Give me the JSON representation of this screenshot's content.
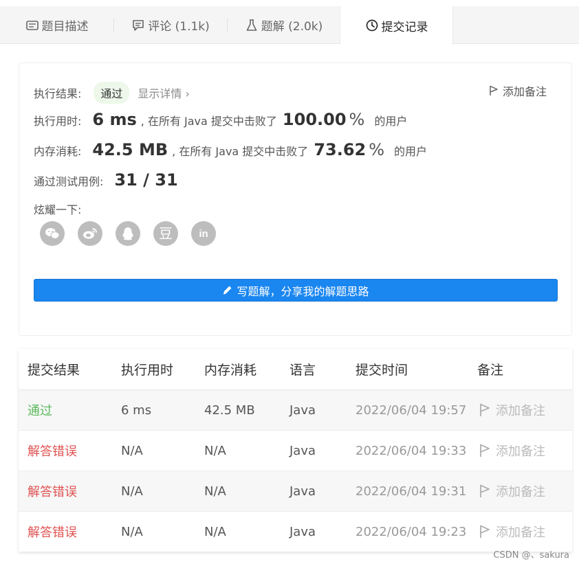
{
  "tabs": [
    {
      "label": "题目描述",
      "icon": "description-icon"
    },
    {
      "label": "评论 (1.1k)",
      "icon": "comment-icon"
    },
    {
      "label": "题解 (2.0k)",
      "icon": "flask-icon"
    },
    {
      "label": "提交记录",
      "icon": "clock-icon"
    }
  ],
  "result": {
    "status_label": "执行结果:",
    "status_value": "通过",
    "detail_link": "显示详情",
    "add_note": "添加备注",
    "runtime_label": "执行用时:",
    "runtime_value": "6 ms",
    "runtime_text": ", 在所有 Java 提交中击败了",
    "runtime_pct": "100.00",
    "runtime_suffix": "的用户",
    "memory_label": "内存消耗:",
    "memory_value": "42.5 MB",
    "memory_text": ", 在所有 Java 提交中击败了",
    "memory_pct": "73.62",
    "memory_suffix": "的用户",
    "tests_label": "通过测试用例:",
    "tests_value": "31 / 31",
    "share_label": "炫耀一下:",
    "share_icons": [
      "wechat-icon",
      "weibo-icon",
      "qq-icon",
      "douban-icon",
      "linkedin-icon"
    ],
    "write_button": "写题解，分享我的解题思路"
  },
  "table": {
    "headers": [
      "提交结果",
      "执行用时",
      "内存消耗",
      "语言",
      "提交时间",
      "备注"
    ],
    "rows": [
      {
        "status": "通过",
        "status_type": "pass",
        "runtime": "6 ms",
        "memory": "42.5 MB",
        "language": "Java",
        "time": "2022/06/04 19:57",
        "note": "添加备注"
      },
      {
        "status": "解答错误",
        "status_type": "fail",
        "runtime": "N/A",
        "memory": "N/A",
        "language": "Java",
        "time": "2022/06/04 19:33",
        "note": "添加备注"
      },
      {
        "status": "解答错误",
        "status_type": "fail",
        "runtime": "N/A",
        "memory": "N/A",
        "language": "Java",
        "time": "2022/06/04 19:31",
        "note": "添加备注"
      },
      {
        "status": "解答错误",
        "status_type": "fail",
        "runtime": "N/A",
        "memory": "N/A",
        "language": "Java",
        "time": "2022/06/04 19:23",
        "note": "添加备注"
      }
    ]
  },
  "watermark": "CSDN @、sakura",
  "colors": {
    "accent": "#1a86f0",
    "pass": "#5cb85c",
    "fail": "#e05252"
  }
}
